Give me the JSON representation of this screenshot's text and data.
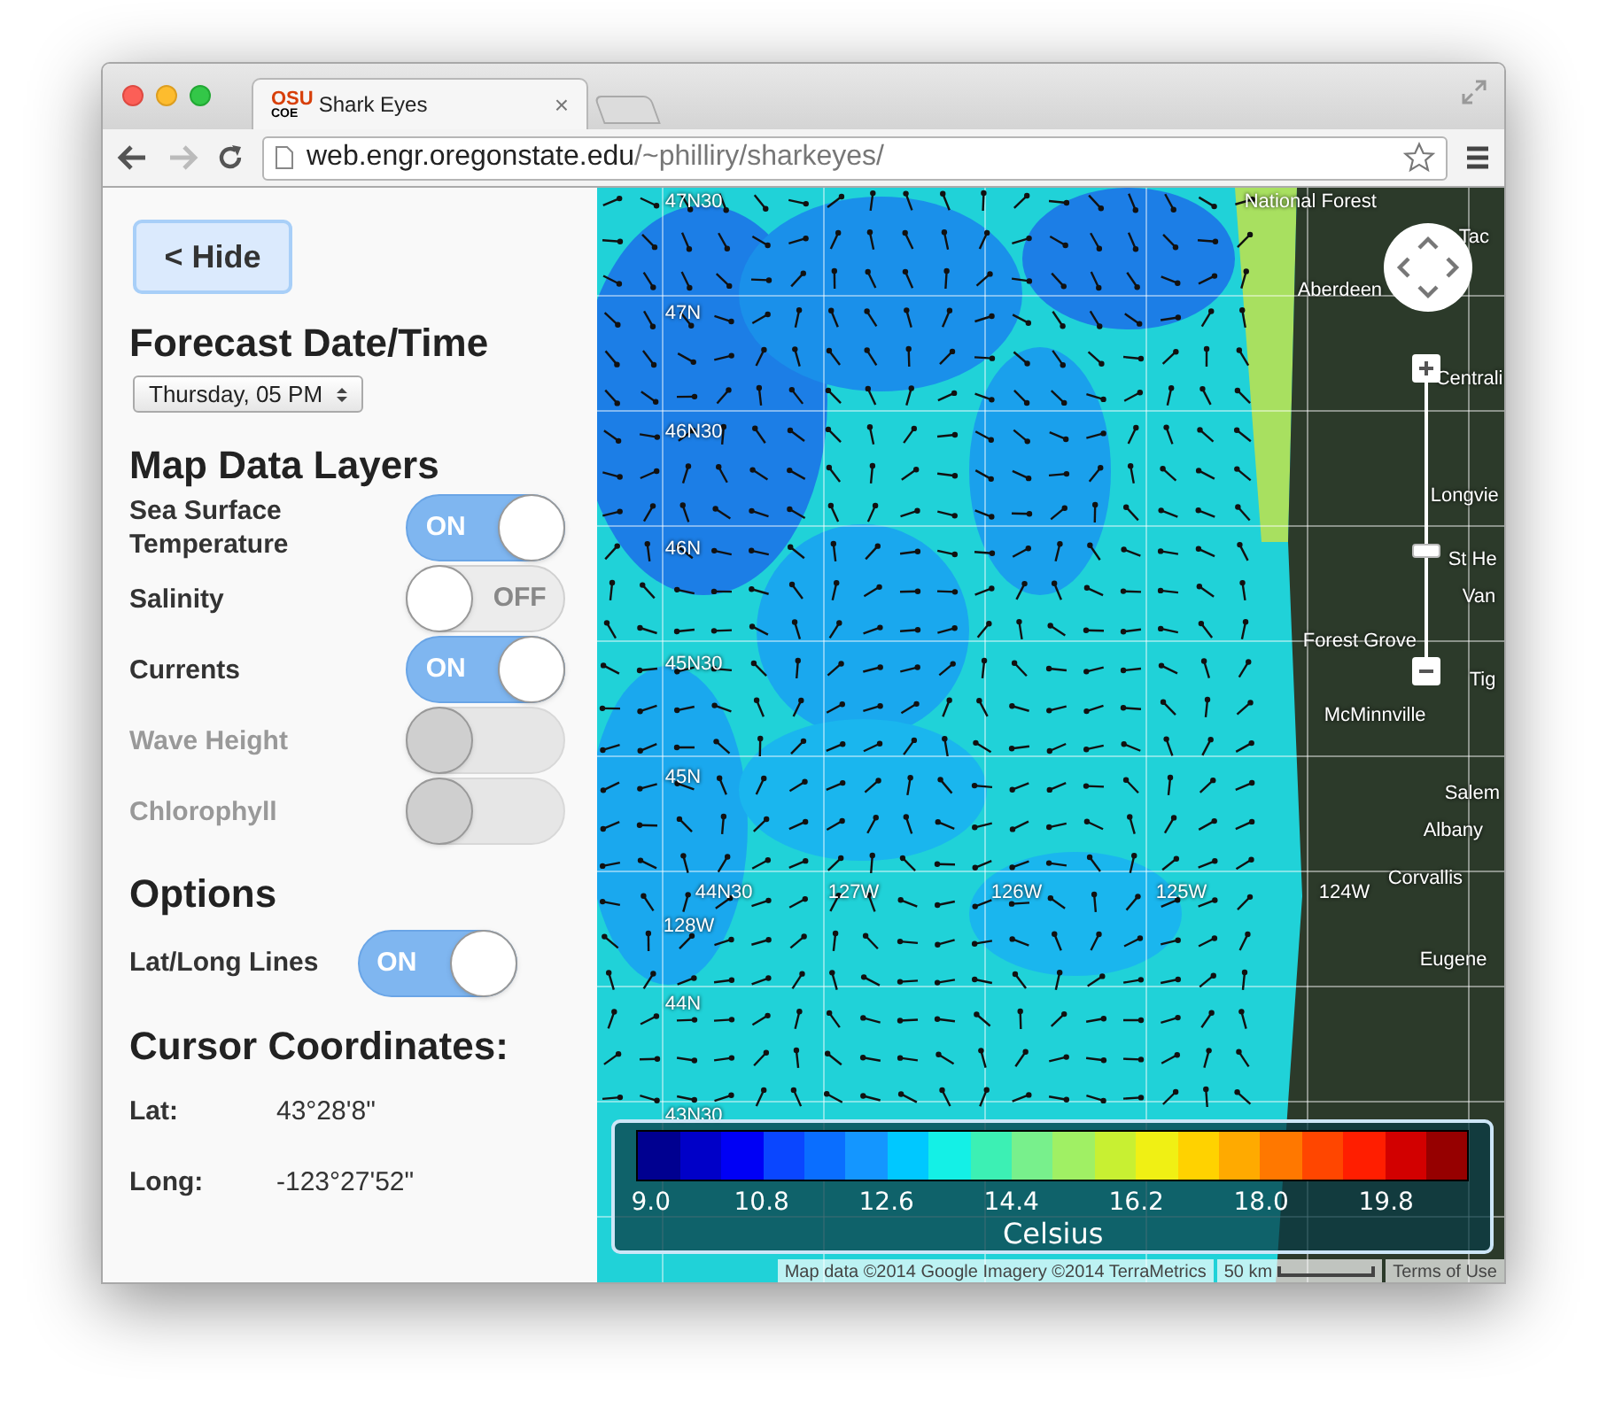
{
  "browser": {
    "tab": {
      "favicon_top": "OSU",
      "favicon_bottom": "COE",
      "title": "Shark Eyes",
      "close": "×"
    },
    "url_host": "web.engr.oregonstate.edu",
    "url_path": "/~philliry/sharkeyes/",
    "back_disabled": false,
    "forward_disabled": true
  },
  "sidebar": {
    "hide_button": "< Hide",
    "forecast": {
      "heading": "Forecast Date/Time",
      "value": "Thursday, 05 PM"
    },
    "layers": {
      "heading": "Map Data Layers",
      "items": [
        {
          "label": "Sea Surface Temperature",
          "on": true,
          "disabled": false,
          "state_text": "ON"
        },
        {
          "label": "Salinity",
          "on": false,
          "disabled": false,
          "state_text": "OFF"
        },
        {
          "label": "Currents",
          "on": true,
          "disabled": false,
          "state_text": "ON"
        },
        {
          "label": "Wave Height",
          "on": false,
          "disabled": true
        },
        {
          "label": "Chlorophyll",
          "on": false,
          "disabled": true
        }
      ]
    },
    "options": {
      "heading": "Options",
      "items": [
        {
          "label": "Lat/Long Lines",
          "on": true,
          "disabled": false,
          "state_text": "ON"
        }
      ]
    },
    "cursor": {
      "heading": "Cursor Coordinates:",
      "rows": [
        {
          "label": "Lat:",
          "value": "43°28'8\""
        },
        {
          "label": "Long:",
          "value": "-123°27'52\""
        }
      ]
    }
  },
  "map": {
    "lat_labels": [
      "47N30",
      "47N",
      "46N30",
      "46N",
      "45N30",
      "45N",
      "44N30",
      "44N",
      "43N30"
    ],
    "lon_labels": [
      "128W",
      "127W",
      "126W",
      "125W",
      "124W"
    ],
    "places": [
      "National Forest",
      "Tac",
      "Aberdeen",
      "Centrali",
      "Longvie",
      "St He",
      "Van",
      "Forest Grove",
      "Tig",
      "McMinnville",
      "Salem",
      "Albany",
      "Corvallis",
      "Eugene"
    ],
    "zoom": {
      "level": 0.39
    },
    "legend": {
      "swatches": [
        {
          "color": "#000090"
        },
        {
          "color": "#0000c8"
        },
        {
          "color": "#0000f5"
        },
        {
          "color": "#0a46ff"
        },
        {
          "color": "#0a6eff"
        },
        {
          "color": "#1496ff"
        },
        {
          "color": "#00c8ff"
        },
        {
          "color": "#14f0e6"
        },
        {
          "color": "#3cf0b4"
        },
        {
          "color": "#78f08c"
        },
        {
          "color": "#a0f064"
        },
        {
          "color": "#c8f032"
        },
        {
          "color": "#f0f014"
        },
        {
          "color": "#ffd200"
        },
        {
          "color": "#ffaa00"
        },
        {
          "color": "#ff7800"
        },
        {
          "color": "#ff4600"
        },
        {
          "color": "#ff1e00"
        },
        {
          "color": "#d20000"
        },
        {
          "color": "#960000"
        }
      ],
      "ticks": [
        "9.0",
        "10.8",
        "12.6",
        "14.4",
        "16.2",
        "18.0",
        "19.8"
      ],
      "unit": "Celsius"
    },
    "attribution": "Map data ©2014 Google Imagery ©2014 TerraMetrics",
    "scale": "50 km",
    "terms": "Terms of Use"
  }
}
